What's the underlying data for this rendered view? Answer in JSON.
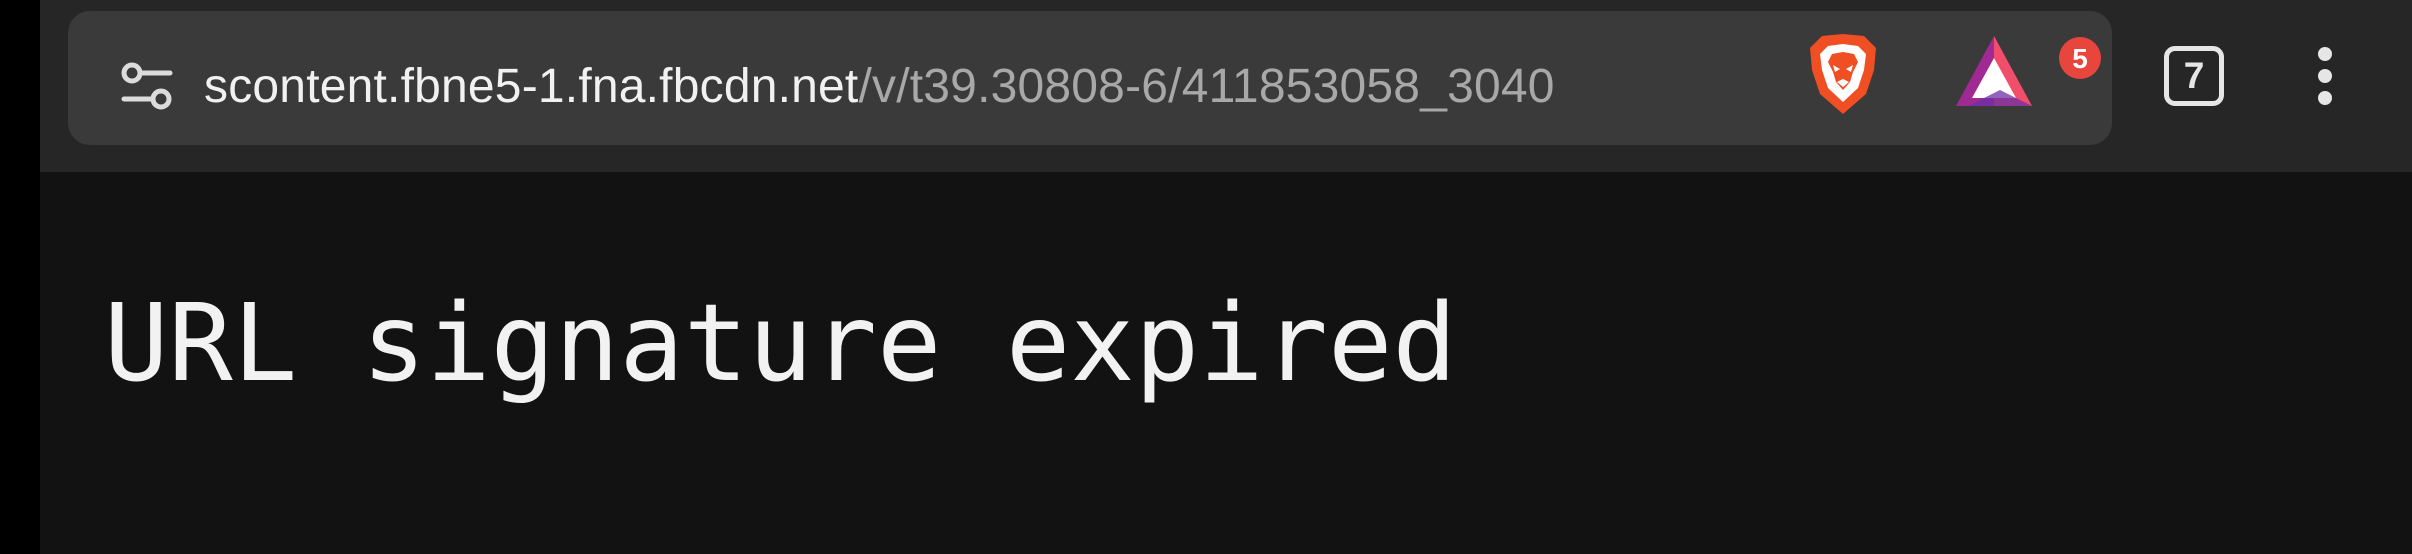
{
  "browser": {
    "address_bar": {
      "url_host": "scontent.fbne5-1.fna.fbcdn.net",
      "url_path": "/v/t39.30808-6/411853058_3040"
    },
    "icons": {
      "site_settings": "tune-sliders-icon",
      "shields": "brave-lion-icon",
      "rewards": "brave-rewards-triangle-icon",
      "menu": "vertical-dots-icon"
    },
    "rewards_badge_count": "5",
    "tab_count": "7",
    "colors": {
      "toolbar": "#262626",
      "address_bar": "#3a3a3a",
      "page_background": "#121212",
      "badge": "#e8453c",
      "shields_orange": "#f04e23"
    }
  },
  "page": {
    "message": "URL signature expired"
  }
}
